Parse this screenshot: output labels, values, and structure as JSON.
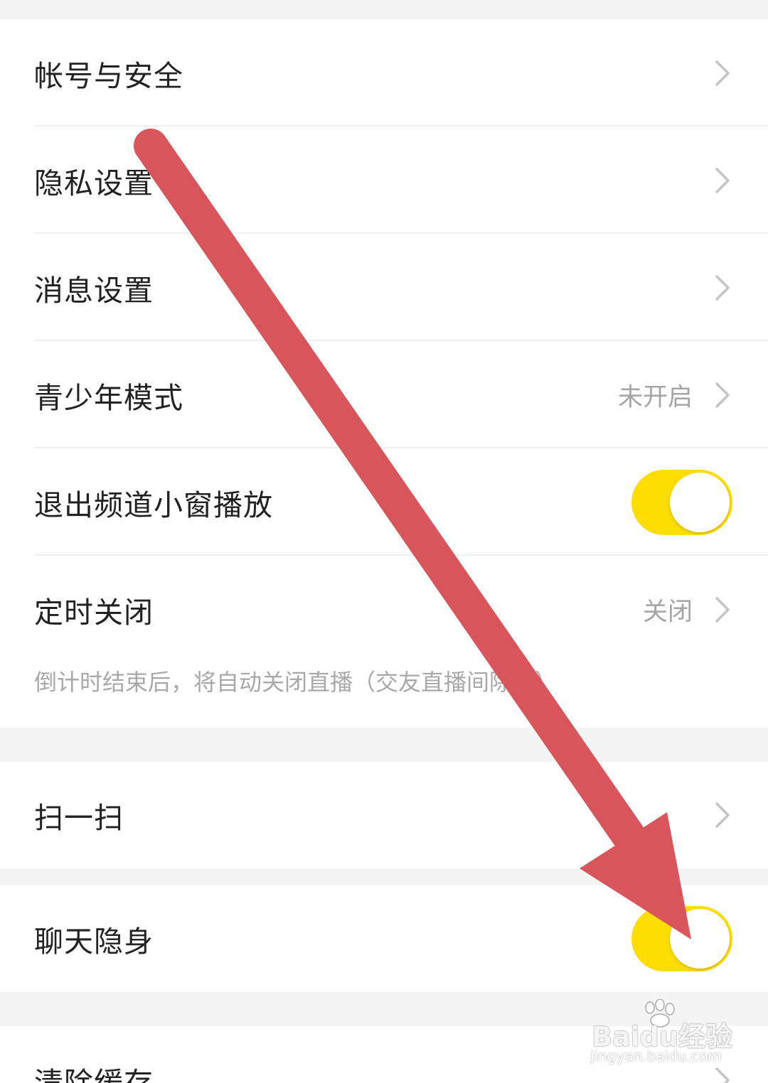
{
  "settings": {
    "account_security": {
      "label": "帐号与安全"
    },
    "privacy": {
      "label": "隐私设置"
    },
    "message": {
      "label": "消息设置"
    },
    "youth_mode": {
      "label": "青少年模式",
      "value": "未开启"
    },
    "exit_channel_mini": {
      "label": "退出频道小窗播放",
      "enabled": true
    },
    "timed_close": {
      "label": "定时关闭",
      "value": "关闭",
      "note": "倒计时结束后，将自动关闭直播（交友直播间除外）"
    },
    "scan": {
      "label": "扫一扫"
    },
    "chat_invisible": {
      "label": "聊天隐身",
      "enabled": true
    },
    "clear_cache": {
      "label": "清除缓存"
    }
  },
  "colors": {
    "toggle_on": "#ffdd00",
    "annotation_arrow": "#d9555c",
    "background": "#f4f4f4"
  },
  "watermark": {
    "text": "Baidu经验",
    "sub": "jingyan.baidu.com"
  }
}
